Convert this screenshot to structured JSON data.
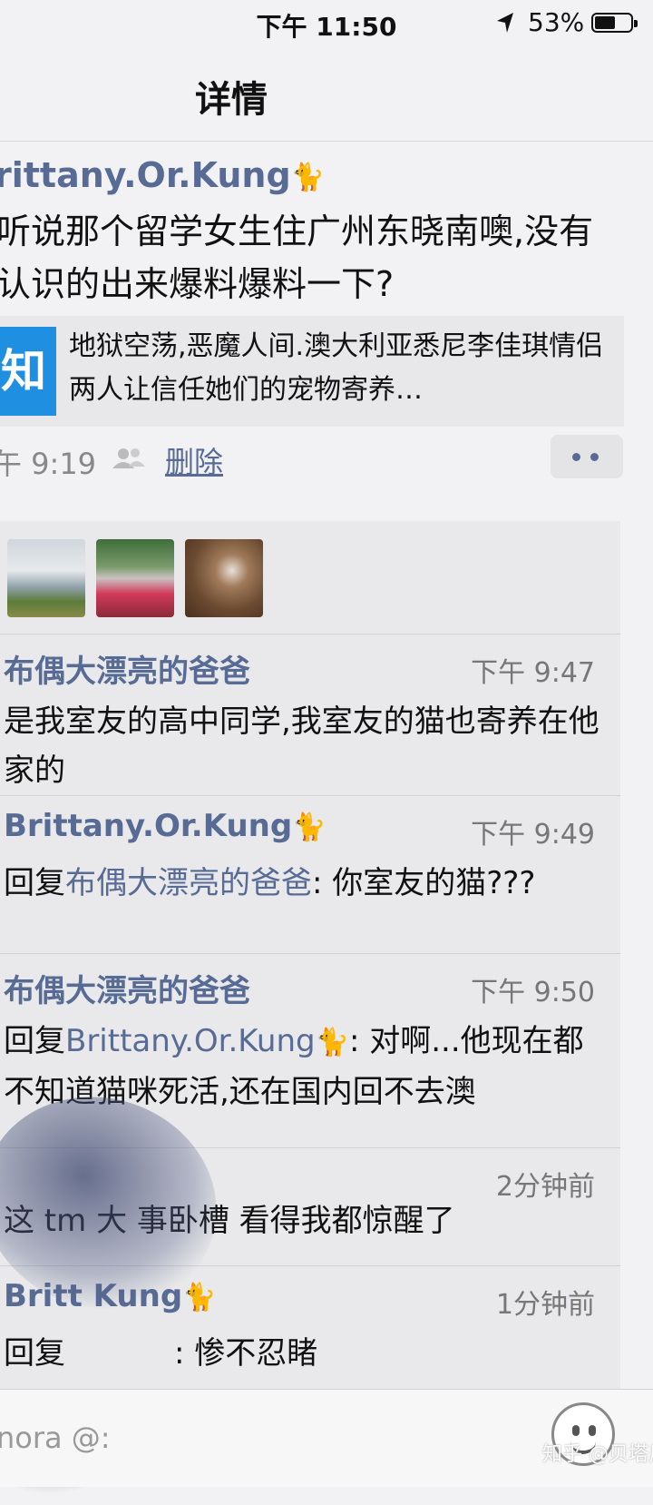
{
  "status_bar": {
    "time": "下午 11:50",
    "battery": "53%"
  },
  "nav": {
    "title": "详情"
  },
  "post": {
    "author": "rittany.Or.Kung",
    "text": "听说那个留学女生住广州东晓南噢,没有认识的出来爆料爆料一下?",
    "link": {
      "logo": "知",
      "text": "地狱空荡,恶魔人间.澳大利亚悉尼李佳琪情侣两人让信任她们的宠物寄养…"
    },
    "time": "午 9:19",
    "delete_label": "删除"
  },
  "comments": [
    {
      "name": "布偶大漂亮的爸爸",
      "time": "下午 9:47",
      "text": "是我室友的高中同学,我室友的猫也寄养在他家的"
    },
    {
      "name": "Brittany.Or.Kung",
      "time": "下午 9:49",
      "reply_prefix": "回复",
      "reply_to": "布偶大漂亮的爸爸",
      "text": ": 你室友的猫???"
    },
    {
      "name": "布偶大漂亮的爸爸",
      "time": "下午 9:50",
      "reply_prefix": "回复",
      "reply_to": "Brittany.Or.Kung",
      "text": ": 对啊...他现在都不知道猫咪死活,还在国内回不去澳"
    },
    {
      "name": "",
      "time": "2分钟前",
      "text": "这 tm 大   事卧槽 看得我都惊醒了"
    },
    {
      "name": "Britt          Kung",
      "time": "1分钟前",
      "reply_prefix": "回复",
      "reply_to": "",
      "text": ": 惨不忍睹"
    }
  ],
  "composer": {
    "placeholder": "nora @:"
  },
  "watermark": "知乎 @贝塔尼",
  "colors": {
    "link": "#576b95",
    "zhihu": "#1e8fe1"
  }
}
